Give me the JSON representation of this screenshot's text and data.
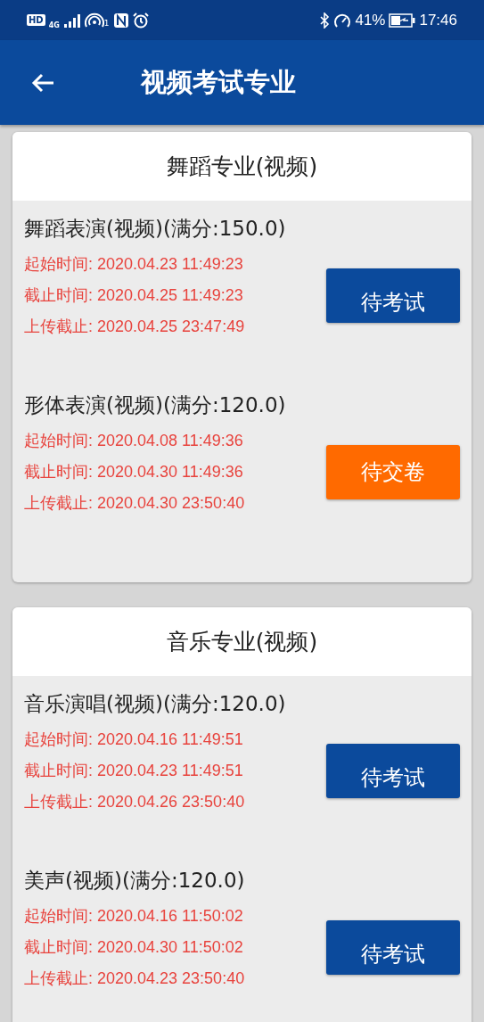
{
  "status_bar": {
    "hd": "HD",
    "network": "4G",
    "hotspot_count": "1",
    "battery": "41%",
    "time": "17:46"
  },
  "app_bar": {
    "title": "视频考试专业"
  },
  "sections": [
    {
      "title": "舞蹈专业(视频)",
      "exams": [
        {
          "title": "舞蹈表演(视频)(满分:150.0)",
          "start": "起始时间: 2020.04.23 11:49:23",
          "end": "截止时间: 2020.04.25 11:49:23",
          "upload": "上传截止: 2020.04.25 23:47:49",
          "button": {
            "label": "待考试",
            "kind": "exam"
          }
        },
        {
          "title": "形体表演(视频)(满分:120.0)",
          "start": "起始时间: 2020.04.08 11:49:36",
          "end": "截止时间: 2020.04.30 11:49:36",
          "upload": "上传截止: 2020.04.30 23:50:40",
          "button": {
            "label": "待交卷",
            "kind": "submit"
          }
        }
      ]
    },
    {
      "title": "音乐专业(视频)",
      "exams": [
        {
          "title": "音乐演唱(视频)(满分:120.0)",
          "start": "起始时间: 2020.04.16 11:49:51",
          "end": "截止时间: 2020.04.23 11:49:51",
          "upload": "上传截止: 2020.04.26 23:50:40",
          "button": {
            "label": "待考试",
            "kind": "exam"
          }
        },
        {
          "title": "美声(视频)(满分:120.0)",
          "start": "起始时间: 2020.04.16 11:50:02",
          "end": "截止时间: 2020.04.30 11:50:02",
          "upload": "上传截止: 2020.04.23 23:50:40",
          "button": {
            "label": "待考试",
            "kind": "exam"
          }
        }
      ]
    }
  ]
}
